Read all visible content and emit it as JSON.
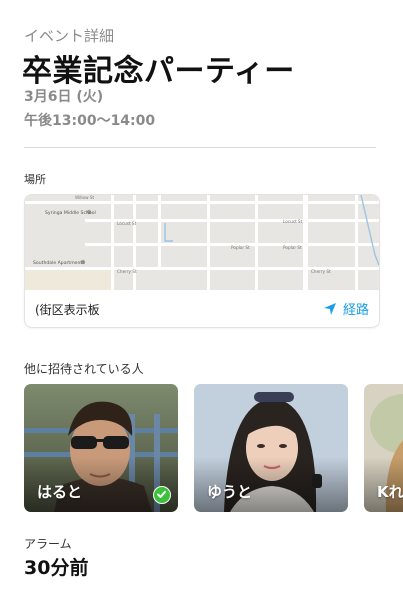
{
  "header": {
    "section_label": "イベント詳細",
    "title": "卒業記念パーティー",
    "date": "3月6日 (火)",
    "time": "午後13:00〜14:00"
  },
  "location": {
    "label": "場所",
    "address": "(街区表示板",
    "directions_label": "経路",
    "map_labels": {
      "school": "Syringa Middle School",
      "apartments": "Southdale Apartments",
      "street_willow": "Willow St",
      "street_locust": "Locust St",
      "street_poplar": "Poplar St",
      "street_cherry": "Cherry St"
    }
  },
  "invited": {
    "label": "他に招待されている人",
    "people": [
      {
        "name": "はると",
        "accepted": true
      },
      {
        "name": "ゆうと",
        "accepted": false
      },
      {
        "name": "Kれ",
        "accepted": false
      }
    ]
  },
  "alarm": {
    "label": "アラーム",
    "value": "30分前"
  },
  "colors": {
    "accent": "#1a9ee6",
    "accepted_green": "#3cc23a",
    "secondary_text": "#8a8a8a"
  }
}
